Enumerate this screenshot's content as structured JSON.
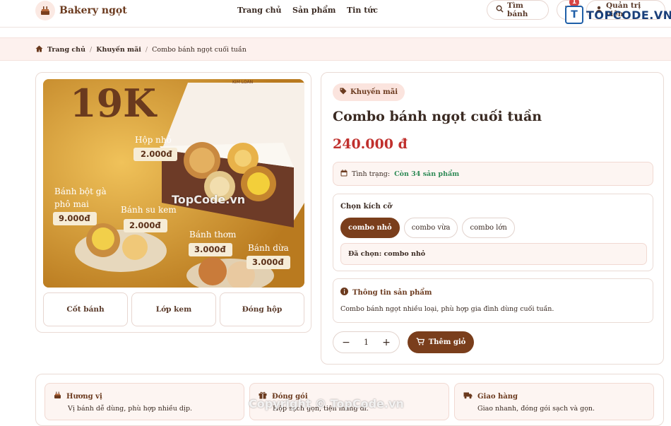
{
  "header": {
    "brand": "Bakery ngọt",
    "nav": [
      "Trang chủ",
      "Sản phẩm",
      "Tin tức"
    ],
    "search_label": "Tìm bánh",
    "cart_count": "1",
    "account_label": "Quản trị viên",
    "watermark": "TOPCODE.VN"
  },
  "breadcrumb": {
    "home": "Trang chủ",
    "category": "Khuyến mãi",
    "current": "Combo bánh ngọt cuối tuần"
  },
  "gallery": {
    "promo_price": "19K",
    "brand_on_box": "KIM LOAN",
    "items": [
      {
        "name": "Hộp nhỏ",
        "price": "2.000đ"
      },
      {
        "name": "Bánh bột gà phô mai",
        "price": "9.000đ"
      },
      {
        "name": "Bánh su kem",
        "price": "2.000đ"
      },
      {
        "name": "Bánh thơm",
        "price": "3.000đ"
      },
      {
        "name": "Bánh dừa",
        "price": "3.000đ"
      }
    ],
    "watermark": "TopCode.vn",
    "thumbs": [
      "Cốt bánh",
      "Lớp kem",
      "Đóng hộp"
    ]
  },
  "product": {
    "tag": "Khuyến mãi",
    "title": "Combo bánh ngọt cuối tuần",
    "price": "240.000 đ",
    "stock_label": "Tình trạng:",
    "stock_value": "Còn 34 sản phẩm",
    "size_title": "Chọn kích cỡ",
    "sizes": [
      "combo nhỏ",
      "combo vừa",
      "combo lớn"
    ],
    "selected": "Đã chọn: combo nhỏ",
    "info_title": "Thông tin sản phẩm",
    "info_text": "Combo bánh ngọt nhiều loại, phù hợp gia đình dùng cuối tuần.",
    "qty": "1",
    "add_label": "Thêm giỏ"
  },
  "features": [
    {
      "title": "Hương vị",
      "text": "Vị bánh dễ dùng, phù hợp nhiều dịp."
    },
    {
      "title": "Đóng gói",
      "text": "Hộp sạch gọn, tiện mang đi."
    },
    {
      "title": "Giao hàng",
      "text": "Giao nhanh, đóng gói sạch và gọn."
    }
  ],
  "copyright_watermark": "Copyright © TopCode.vn",
  "colors": {
    "brand": "#7a3e1c",
    "price": "#c0302d",
    "stock": "#2e8a56",
    "soft_bg": "#fdf1ee"
  }
}
